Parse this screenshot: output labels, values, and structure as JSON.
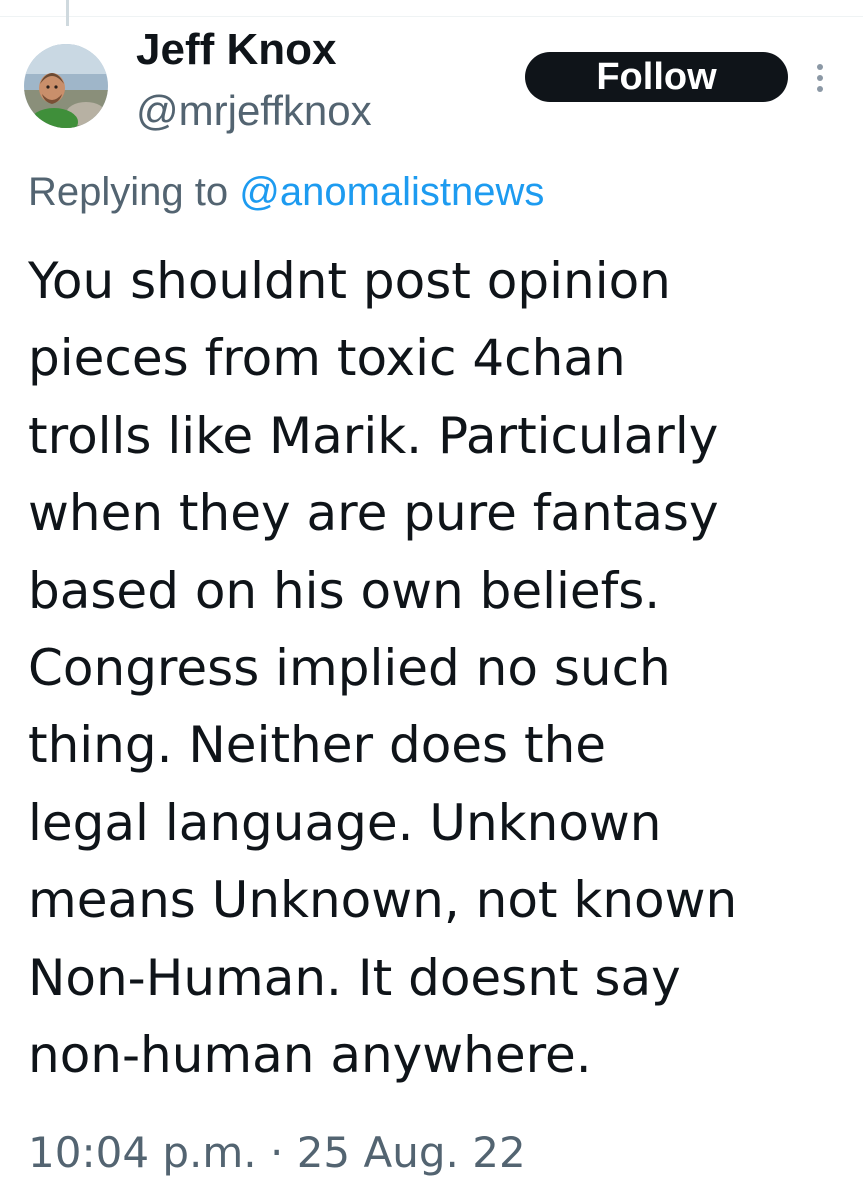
{
  "author": {
    "name": "Jeff Knox",
    "handle": "@mrjeffknox"
  },
  "follow_button": {
    "label": "Follow"
  },
  "reply": {
    "prefix": "Replying to ",
    "mention": "@anomalistnews"
  },
  "tweet": {
    "lines": [
      "You shouldnt post opinion",
      "pieces from toxic 4chan",
      "trolls like Marik. Particularly",
      "when they are pure fantasy",
      "based on his own beliefs.",
      "Congress implied no such",
      "thing. Neither does the",
      "legal language. Unknown",
      "means Unknown, not known",
      "Non-Human. It doesnt say",
      "non-human anywhere."
    ]
  },
  "meta": {
    "timestamp": "10:04 p.m. · 25 Aug. 22"
  },
  "icons": {
    "more": "more-vertical-icon",
    "avatar": "avatar-photo"
  },
  "colors": {
    "text": "#0f1419",
    "secondary": "#536471",
    "link": "#1d9bf0",
    "button_bg": "#0f1419",
    "button_text": "#ffffff"
  }
}
